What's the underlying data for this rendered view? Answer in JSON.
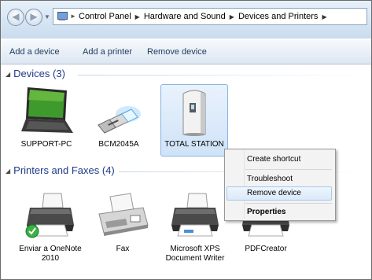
{
  "breadcrumb": {
    "items": [
      "Control Panel",
      "Hardware and Sound",
      "Devices and Printers"
    ]
  },
  "toolbar": {
    "add_device": "Add a device",
    "add_printer": "Add a printer",
    "remove_device": "Remove device"
  },
  "groups": {
    "devices": "Devices (3)",
    "printers": "Printers and Faxes (4)"
  },
  "devices": [
    {
      "label": "SUPPORT-PC",
      "icon": "laptop-icon"
    },
    {
      "label": "BCM2045A",
      "icon": "usb-bluetooth-adapter-icon"
    },
    {
      "label": "TOTAL STATION",
      "icon": "device-tower-icon"
    }
  ],
  "printers": [
    {
      "label_line1": "Enviar a OneNote",
      "label_line2": "2010",
      "icon": "printer-icon",
      "default": true
    },
    {
      "label_line1": "Fax",
      "label_line2": "",
      "icon": "fax-icon"
    },
    {
      "label_line1": "Microsoft XPS",
      "label_line2": "Document Writer",
      "icon": "printer-icon"
    },
    {
      "label_line1": "PDFCreator",
      "label_line2": "",
      "icon": "printer-icon"
    }
  ],
  "context_menu": {
    "items": [
      "Create shortcut",
      "Troubleshoot",
      "Remove device",
      "Properties"
    ],
    "highlighted": "Remove device"
  },
  "colors": {
    "accent": "#1e3a8a",
    "selection": "#cfe3f8"
  }
}
